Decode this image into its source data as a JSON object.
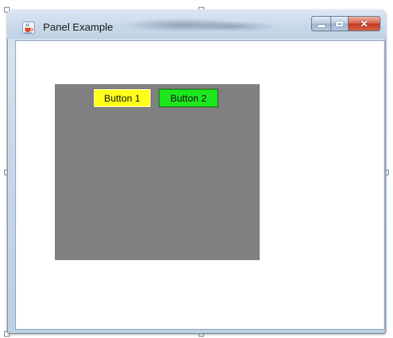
{
  "window": {
    "title": "Panel Example",
    "app_icon": "java-cup-icon",
    "controls": {
      "minimize_icon": "minimize-icon",
      "maximize_icon": "maximize-icon",
      "close_icon": "close-icon",
      "close_glyph": "✕"
    }
  },
  "panel": {
    "background": "#808080",
    "buttons": [
      {
        "label": "Button 1",
        "color": "#ffff1a"
      },
      {
        "label": "Button 2",
        "color": "#1ee61e"
      }
    ]
  }
}
